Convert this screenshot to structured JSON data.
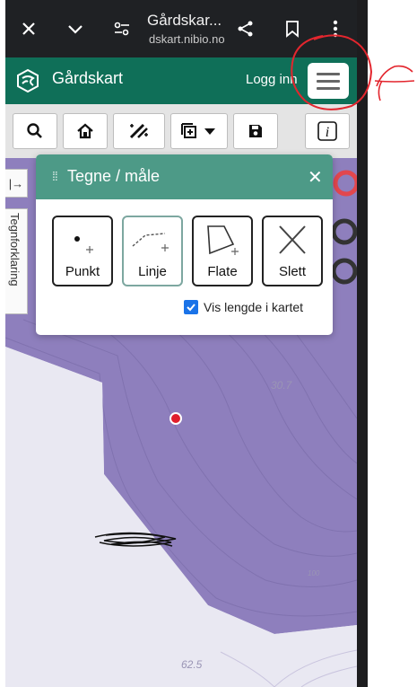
{
  "browser": {
    "title": "Gårdskar...",
    "url": "dskart.nibio.no",
    "icons": [
      "close-icon",
      "chevron-down-icon",
      "tune-icon",
      "share-icon",
      "bookmark-icon",
      "more-vert-icon"
    ]
  },
  "app": {
    "title": "Gårdskart",
    "login": "Logg inn",
    "brand_color": "#0f6f58"
  },
  "toolbar": {
    "icons": [
      "search-icon",
      "home-icon",
      "measure-tools-icon",
      "add-layer-icon",
      "save-icon",
      "info-icon"
    ]
  },
  "sidebar": {
    "expand_label": "|→",
    "legend_label": "Tegnforklaring"
  },
  "dialog": {
    "title": "Tegne / måle",
    "close": "✕",
    "header_color": "#4d9a87",
    "tools": [
      {
        "label": "Punkt",
        "icon": "point-icon"
      },
      {
        "label": "Linje",
        "icon": "line-icon"
      },
      {
        "label": "Flate",
        "icon": "polygon-icon"
      },
      {
        "label": "Slett",
        "icon": "delete-icon"
      }
    ],
    "checkbox_label": "Vis lengde i kartet",
    "checkbox_checked": true
  },
  "map": {
    "labels": [
      "30.7",
      "62.5",
      "100"
    ],
    "area_color": "#8e7fbd"
  }
}
